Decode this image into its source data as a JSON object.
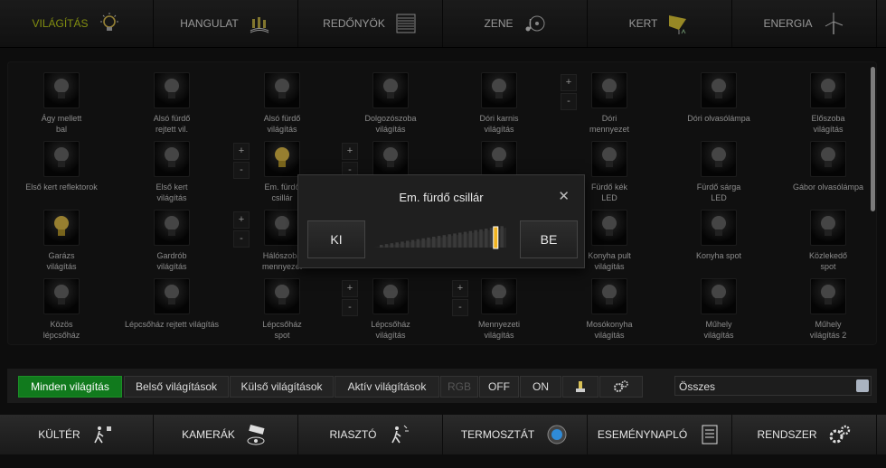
{
  "top_nav": [
    {
      "label": "VILÁGÍTÁS",
      "icon": "bulb-icon",
      "active": true
    },
    {
      "label": "HANGULAT",
      "icon": "candles-icon"
    },
    {
      "label": "REDŐNYÖK",
      "icon": "blinds-icon"
    },
    {
      "label": "ZENE",
      "icon": "music-icon"
    },
    {
      "label": "KERT",
      "icon": "garden-light-icon"
    },
    {
      "label": "ENERGIA",
      "icon": "wind-turbine-icon"
    }
  ],
  "lights": [
    {
      "name": "Ágy mellett\nbal",
      "on": false
    },
    {
      "name": "Alsó fürdő\nrejtett vil.",
      "on": false
    },
    {
      "name": "Alsó fürdő\nvilágítás",
      "on": false
    },
    {
      "name": "Dolgozószoba\nvilágítás",
      "on": false
    },
    {
      "name": "Dóri karnis\nvilágítás",
      "on": false
    },
    {
      "name": "Dóri\nmennyezet",
      "on": false
    },
    {
      "name": "Dóri olvasólámpa",
      "on": false
    },
    {
      "name": "Előszoba\nvilágítás",
      "on": false
    },
    {
      "name": "Első kert reflektorok",
      "on": false
    },
    {
      "name": "Első kert\nvilágítás",
      "on": false
    },
    {
      "name": "Em. fürdő\ncsillár",
      "on": true
    },
    {
      "name": "",
      "on": false
    },
    {
      "name": "",
      "on": false
    },
    {
      "name": "Fürdő kék\nLED",
      "on": false
    },
    {
      "name": "Fürdő sárga\nLED",
      "on": false
    },
    {
      "name": "Gábor olvasólámpa",
      "on": false
    },
    {
      "name": "Garázs\nvilágítás",
      "on": true
    },
    {
      "name": "Gardrób\nvilágítás",
      "on": false
    },
    {
      "name": "Hálószoba\nmennyezet",
      "on": false
    },
    {
      "name": "",
      "on": false
    },
    {
      "name": "",
      "on": false
    },
    {
      "name": "Konyha pult\nvilágítás",
      "on": false
    },
    {
      "name": "Konyha spot",
      "on": false
    },
    {
      "name": "Közlekedő\nspot",
      "on": false
    },
    {
      "name": "Közös\nlépcsőház",
      "on": false
    },
    {
      "name": "Lépcsőház rejtett világítás",
      "on": false
    },
    {
      "name": "Lépcsőház\nspot",
      "on": false
    },
    {
      "name": "Lépcsőház\nvilágítás",
      "on": false
    },
    {
      "name": "Mennyezeti\nvilágítás",
      "on": false
    },
    {
      "name": "Mosókonyha\nvilágítás",
      "on": false
    },
    {
      "name": "Műhely\nvilágítás",
      "on": false
    },
    {
      "name": "Műhely\nvilágítás 2",
      "on": false
    }
  ],
  "dimmer_controls": {
    "plus": "+",
    "minus": "-"
  },
  "dialog": {
    "title": "Em. fürdő csillár",
    "close": "✕",
    "off_label": "KI",
    "on_label": "BE",
    "level": 0.93
  },
  "filters": [
    {
      "label": "Minden világítás",
      "active": true
    },
    {
      "label": "Belső világítások"
    },
    {
      "label": "Külső világítások"
    },
    {
      "label": "Aktív világítások"
    },
    {
      "label": "RGB",
      "disabled": true
    },
    {
      "label": "OFF"
    },
    {
      "label": "ON"
    }
  ],
  "filter_icons": [
    "bulb-settings-icon",
    "gears-icon"
  ],
  "select": {
    "value": "Összes"
  },
  "bottom_nav": [
    {
      "label": "KÜLTÉR",
      "icon": "motion-sensor-icon"
    },
    {
      "label": "KAMERÁK",
      "icon": "camera-icon"
    },
    {
      "label": "RIASZTÓ",
      "icon": "alarm-runner-icon"
    },
    {
      "label": "TERMOSZTÁT",
      "icon": "thermostat-icon"
    },
    {
      "label": "ESEMÉNYNAPLÓ",
      "icon": "log-icon"
    },
    {
      "label": "RENDSZER",
      "icon": "gears-icon"
    }
  ],
  "colors": {
    "accent": "#c7d919",
    "active_filter": "#117a1d",
    "bulb_on": "#e8c34a"
  }
}
